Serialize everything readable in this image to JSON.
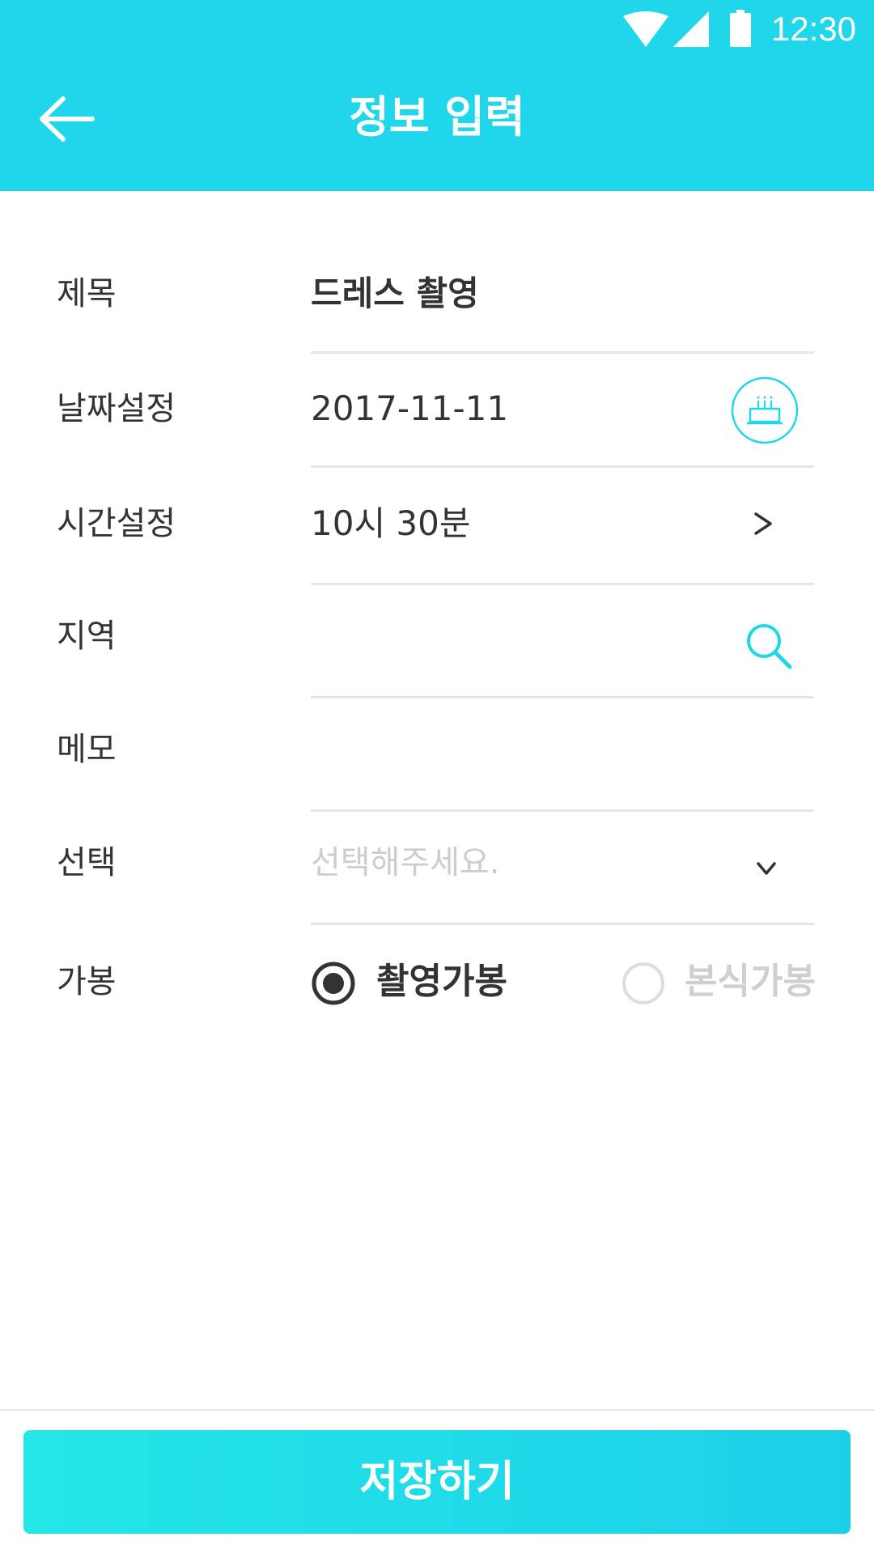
{
  "status_bar": {
    "time": "12:30"
  },
  "header": {
    "title": "정보 입력"
  },
  "form": {
    "title": {
      "label": "제목",
      "value": "드레스 촬영"
    },
    "date": {
      "label": "날짜설정",
      "value": "2017-11-11"
    },
    "time": {
      "label": "시간설정",
      "value": "10시 30분"
    },
    "region": {
      "label": "지역",
      "value": ""
    },
    "memo": {
      "label": "메모",
      "value": ""
    },
    "select": {
      "label": "선택",
      "placeholder": "선택해주세요."
    },
    "gabong": {
      "label": "가봉",
      "options": [
        {
          "label": "촬영가봉",
          "selected": true
        },
        {
          "label": "본식가봉",
          "selected": false
        }
      ]
    }
  },
  "footer": {
    "save_label": "저장하기"
  },
  "colors": {
    "accent": "#20d6ea",
    "divider": "#e6e6e6",
    "text": "#333333",
    "placeholder": "#cdcdcd"
  }
}
